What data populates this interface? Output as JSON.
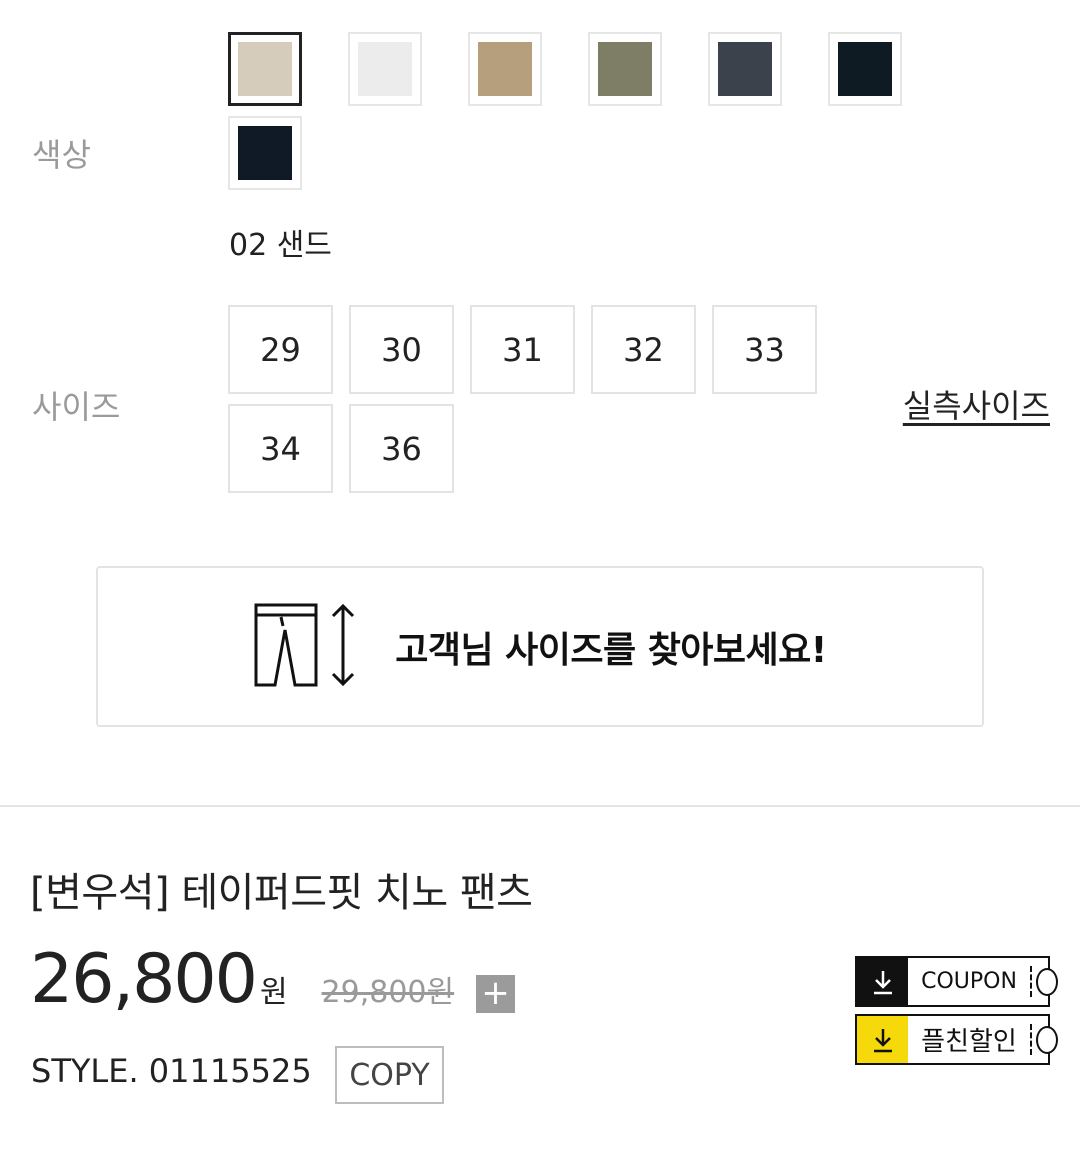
{
  "color": {
    "label": "색상",
    "selected_text": "02 샌드",
    "swatches": [
      {
        "hex": "#d6ccbb",
        "selected": true
      },
      {
        "hex": "#ececec",
        "selected": false
      },
      {
        "hex": "#b59f7c",
        "selected": false
      },
      {
        "hex": "#7d7e65",
        "selected": false
      },
      {
        "hex": "#3c424b",
        "selected": false
      },
      {
        "hex": "#0f1b22",
        "selected": false
      },
      {
        "hex": "#0f1a26",
        "selected": false
      }
    ]
  },
  "size": {
    "label": "사이즈",
    "options": [
      "29",
      "30",
      "31",
      "32",
      "33",
      "34",
      "36"
    ],
    "size_chart_link": "실측사이즈"
  },
  "size_finder": {
    "text": "고객님 사이즈를 찾아보세요!"
  },
  "product": {
    "title": "[변우석] 테이퍼드핏 치노 팬츠",
    "price": "26,800",
    "currency": "원",
    "original_price": "29,800원",
    "plus": "+",
    "style_text": "STYLE. 01115525",
    "copy_label": "COPY"
  },
  "coupons": [
    {
      "label": "COUPON",
      "icon_bg": "#111111",
      "icon_color": "#ffffff"
    },
    {
      "label": "플친할인",
      "icon_bg": "#f5d90a",
      "icon_color": "#111111"
    }
  ]
}
